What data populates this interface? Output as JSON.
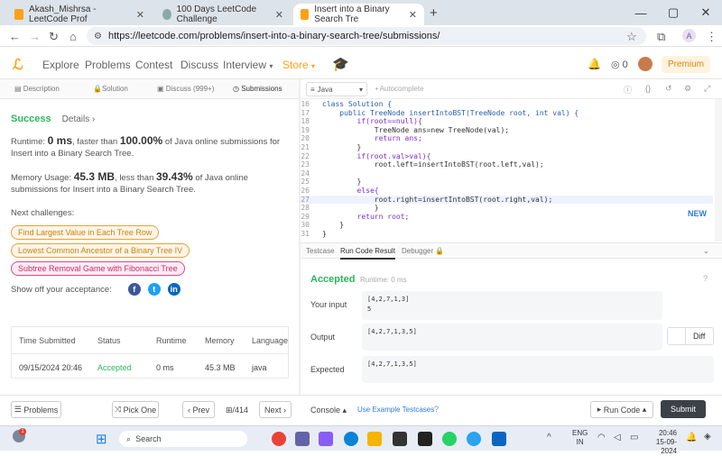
{
  "browser": {
    "tabs": [
      {
        "label": "Akash_Mishrsa - LeetCode Prof",
        "active": false
      },
      {
        "label": "100 Days LeetCode Challenge",
        "active": false
      },
      {
        "label": "Insert into a Binary Search Tre",
        "active": true
      }
    ],
    "url": "https://leetcode.com/problems/insert-into-a-binary-search-tree/submissions/",
    "profile_initial": "A"
  },
  "leetcode_nav": {
    "items": [
      "Explore",
      "Problems",
      "Contest",
      "Discuss",
      "Interview",
      "Store"
    ],
    "coins": "0",
    "premium_label": "Premium"
  },
  "panel_tabs": [
    "Description",
    "Solution",
    "Discuss (999+)",
    "Submissions"
  ],
  "submission": {
    "status": "Success",
    "details_label": "Details",
    "runtime_prefix": "Runtime: ",
    "runtime_value": "0 ms",
    "runtime_mid": ", faster than ",
    "runtime_pct": "100.00%",
    "runtime_suffix": " of Java online submissions for Insert into a Binary Search Tree.",
    "memory_prefix": "Memory Usage: ",
    "memory_value": "45.3 MB",
    "memory_mid": ", less than ",
    "memory_pct": "39.43%",
    "memory_suffix": " of Java online submissions for Insert into a Binary Search Tree.",
    "next_label": "Next challenges:",
    "challenges": [
      {
        "label": "Find Largest Value in Each Tree Row",
        "color": "#e6a23c"
      },
      {
        "label": "Lowest Common Ancestor of a Binary Tree IV",
        "color": "#e6a23c"
      },
      {
        "label": "Subtree Removal Game with Fibonacci Tree",
        "color": "#d64b8a"
      }
    ],
    "share_label": "Show off your acceptance:"
  },
  "table": {
    "headers": [
      "Time Submitted",
      "Status",
      "Runtime",
      "Memory",
      "Language"
    ],
    "row": [
      "09/15/2024 20:46",
      "Accepted",
      "0 ms",
      "45.3 MB",
      "java"
    ]
  },
  "editor": {
    "language": "Java",
    "autocomplete": "Autocomplete",
    "lines": [
      {
        "n": "16",
        "code": "class Solution {"
      },
      {
        "n": "17",
        "code": "    public TreeNode insertIntoBST(TreeNode root, int val) {"
      },
      {
        "n": "18",
        "code": "        if(root==null){"
      },
      {
        "n": "19",
        "code": "            TreeNode ans=new TreeNode(val);"
      },
      {
        "n": "20",
        "code": "            return ans;"
      },
      {
        "n": "21",
        "code": "        }"
      },
      {
        "n": "22",
        "code": "        if(root.val>val){"
      },
      {
        "n": "23",
        "code": "            root.left=insertIntoBST(root.left,val);"
      },
      {
        "n": "24",
        "code": ""
      },
      {
        "n": "25",
        "code": "        }"
      },
      {
        "n": "26",
        "code": "        else{"
      },
      {
        "n": "27",
        "code": "            root.right=insertIntoBST(root.right,val);"
      },
      {
        "n": "28",
        "code": "            }"
      },
      {
        "n": "29",
        "code": "        return root;"
      },
      {
        "n": "30",
        "code": "    }"
      },
      {
        "n": "31",
        "code": "}"
      }
    ],
    "new_label": "NEW"
  },
  "result_tabs": [
    "Testcase",
    "Run Code Result",
    "Debugger"
  ],
  "result": {
    "status": "Accepted",
    "runtime": "Runtime: 0 ms",
    "input_label": "Your input",
    "input_line1": "[4,2,7,1,3]",
    "input_line2": "5",
    "output_label": "Output",
    "output": "[4,2,7,1,3,5]",
    "expected_label": "Expected",
    "expected": "[4,2,7,1,3,5]",
    "diff_label": "Diff"
  },
  "bottom": {
    "problems": "Problems",
    "pick_one": "Pick One",
    "prev": "Prev",
    "page": "/414",
    "next": "Next",
    "console": "Console",
    "use_example": "Use Example Testcases",
    "run_code": "Run Code",
    "submit": "Submit"
  },
  "taskbar": {
    "search": "Search",
    "lang": "ENG",
    "region": "IN",
    "time": "20:46",
    "date": "15-09-2024",
    "badge": "1"
  },
  "colors": {
    "success": "#2db55d",
    "accent": "#ffa116",
    "link": "#2d7be0"
  }
}
